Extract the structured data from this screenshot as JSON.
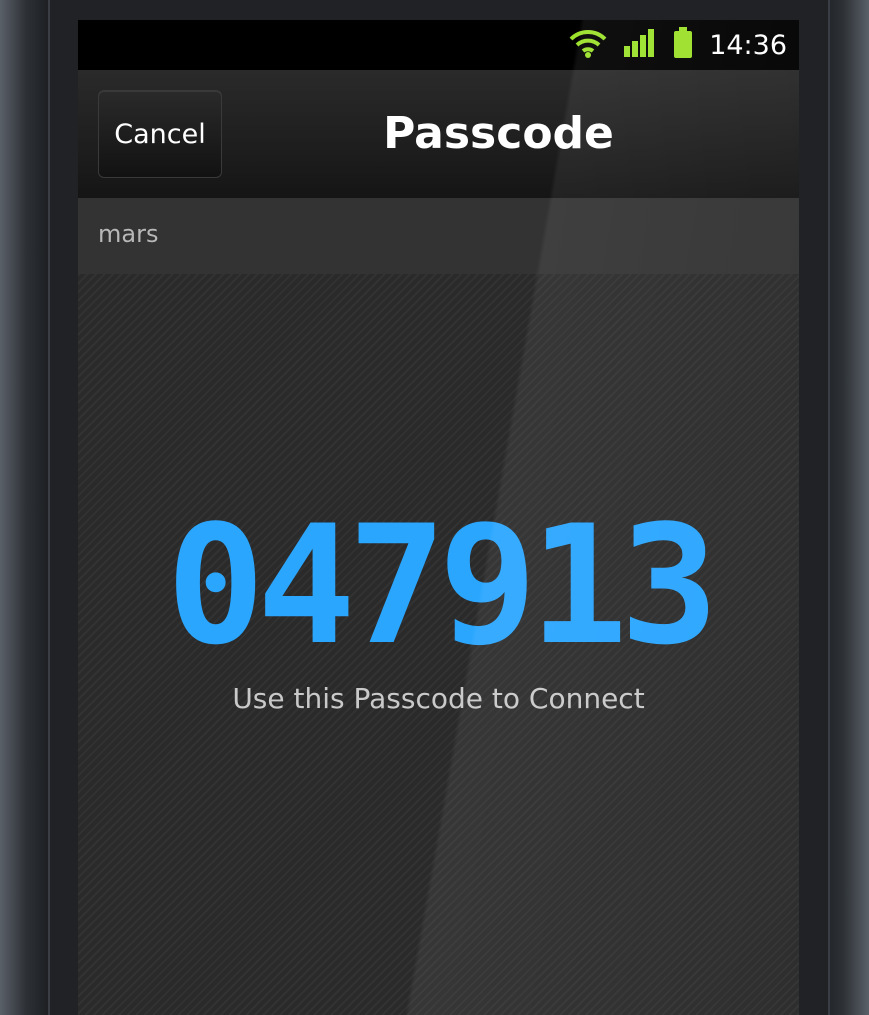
{
  "status_bar": {
    "time": "14:36",
    "icons": [
      "wifi-icon",
      "signal-icon",
      "battery-icon"
    ],
    "icon_color": "#9be02a"
  },
  "header": {
    "cancel_label": "Cancel",
    "title": "Passcode"
  },
  "device": {
    "name": "mars"
  },
  "main": {
    "passcode": "047913",
    "hint": "Use this Passcode to Connect",
    "passcode_color": "#2aa6ff"
  }
}
